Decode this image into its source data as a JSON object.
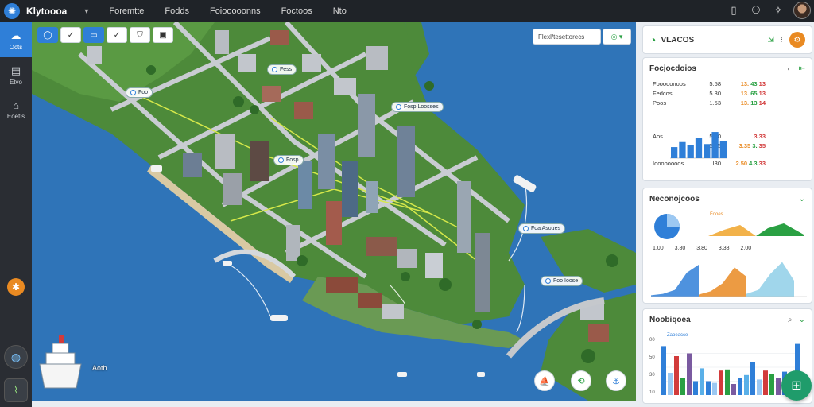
{
  "app": {
    "title": "Klytoooa"
  },
  "menu": [
    "Foremtte",
    "Fodds",
    "Foiooooonns",
    "Foctoos",
    "Nto"
  ],
  "rail": [
    {
      "label": "Octs",
      "icon": "cloud-icon"
    },
    {
      "label": "Etvo",
      "icon": "file-icon"
    },
    {
      "label": "Eoetis",
      "icon": "bag-icon"
    }
  ],
  "map": {
    "search_placeholder": "Flexl/tesettorecs",
    "pins": [
      {
        "label": "Foo"
      },
      {
        "label": "Fosp Loosses"
      },
      {
        "label": "Fosp"
      },
      {
        "label": "Fess"
      },
      {
        "label": "Foa Asoues"
      },
      {
        "label": "Foo Ioose"
      }
    ],
    "place_label": "Aoth"
  },
  "panel": {
    "header": {
      "title": "VLACOS"
    },
    "kpi": {
      "title": "Focjocdoios",
      "rows": [
        {
          "label": "Fooooonoos",
          "a": "5.58",
          "b1": "13.",
          "b2": "43",
          "b3": "13"
        },
        {
          "label": "Fedcos",
          "a": "5.30",
          "b1": "13.",
          "b2": "65",
          "b3": "13"
        },
        {
          "label": "Poos",
          "a": "1.53",
          "b1": "13.",
          "b2": "13",
          "b3": "14"
        },
        {
          "label": "Aos",
          "a": "5.30",
          "b1": "",
          "b2": "",
          "b3": "3.33"
        },
        {
          "label": "",
          "a": "5.35",
          "b1": "3.35",
          "b2": "3.",
          "b3": "35"
        },
        {
          "label": "Ioooooooos",
          "a": "I30",
          "b1": "2.50",
          "b2": "4.3",
          "b3": "33"
        }
      ],
      "chart_data": {
        "type": "bar",
        "categories": [
          "1",
          "2",
          "3",
          "4",
          "5",
          "6",
          "7"
        ],
        "values": [
          22,
          32,
          26,
          40,
          28,
          52,
          34
        ],
        "ylim": [
          0,
          60
        ]
      }
    },
    "trends": {
      "title": "Neconojcoos",
      "small_label": "Fooes",
      "row_values": [
        "1.00",
        "3.80",
        "3.80",
        "3.38",
        "2.00"
      ],
      "chart_data": {
        "type": "area",
        "series": [
          {
            "values": [
              2,
              4,
              10,
              36,
              48
            ]
          },
          {
            "values": [
              3,
              8,
              20,
              44,
              30
            ]
          },
          {
            "values": [
              4,
              10,
              34,
              52,
              24
            ]
          }
        ],
        "ylim": [
          0,
          60
        ]
      }
    },
    "history": {
      "title": "Noobiqoea",
      "filter_label": "Zaoeacce",
      "yticks": [
        "00",
        "50",
        "30",
        "10"
      ],
      "chart_data": {
        "type": "bar",
        "categories": [
          "1",
          "2",
          "3",
          "4",
          "5",
          "6",
          "7",
          "8",
          "9",
          "10",
          "11",
          "12",
          "13",
          "14",
          "15",
          "16",
          "17",
          "18",
          "19",
          "20",
          "21",
          "22"
        ],
        "values": [
          88,
          40,
          70,
          30,
          75,
          25,
          48,
          25,
          22,
          44,
          46,
          20,
          30,
          36,
          60,
          28,
          44,
          38,
          30,
          42,
          28,
          92
        ],
        "ylim": [
          0,
          100
        ]
      }
    }
  }
}
